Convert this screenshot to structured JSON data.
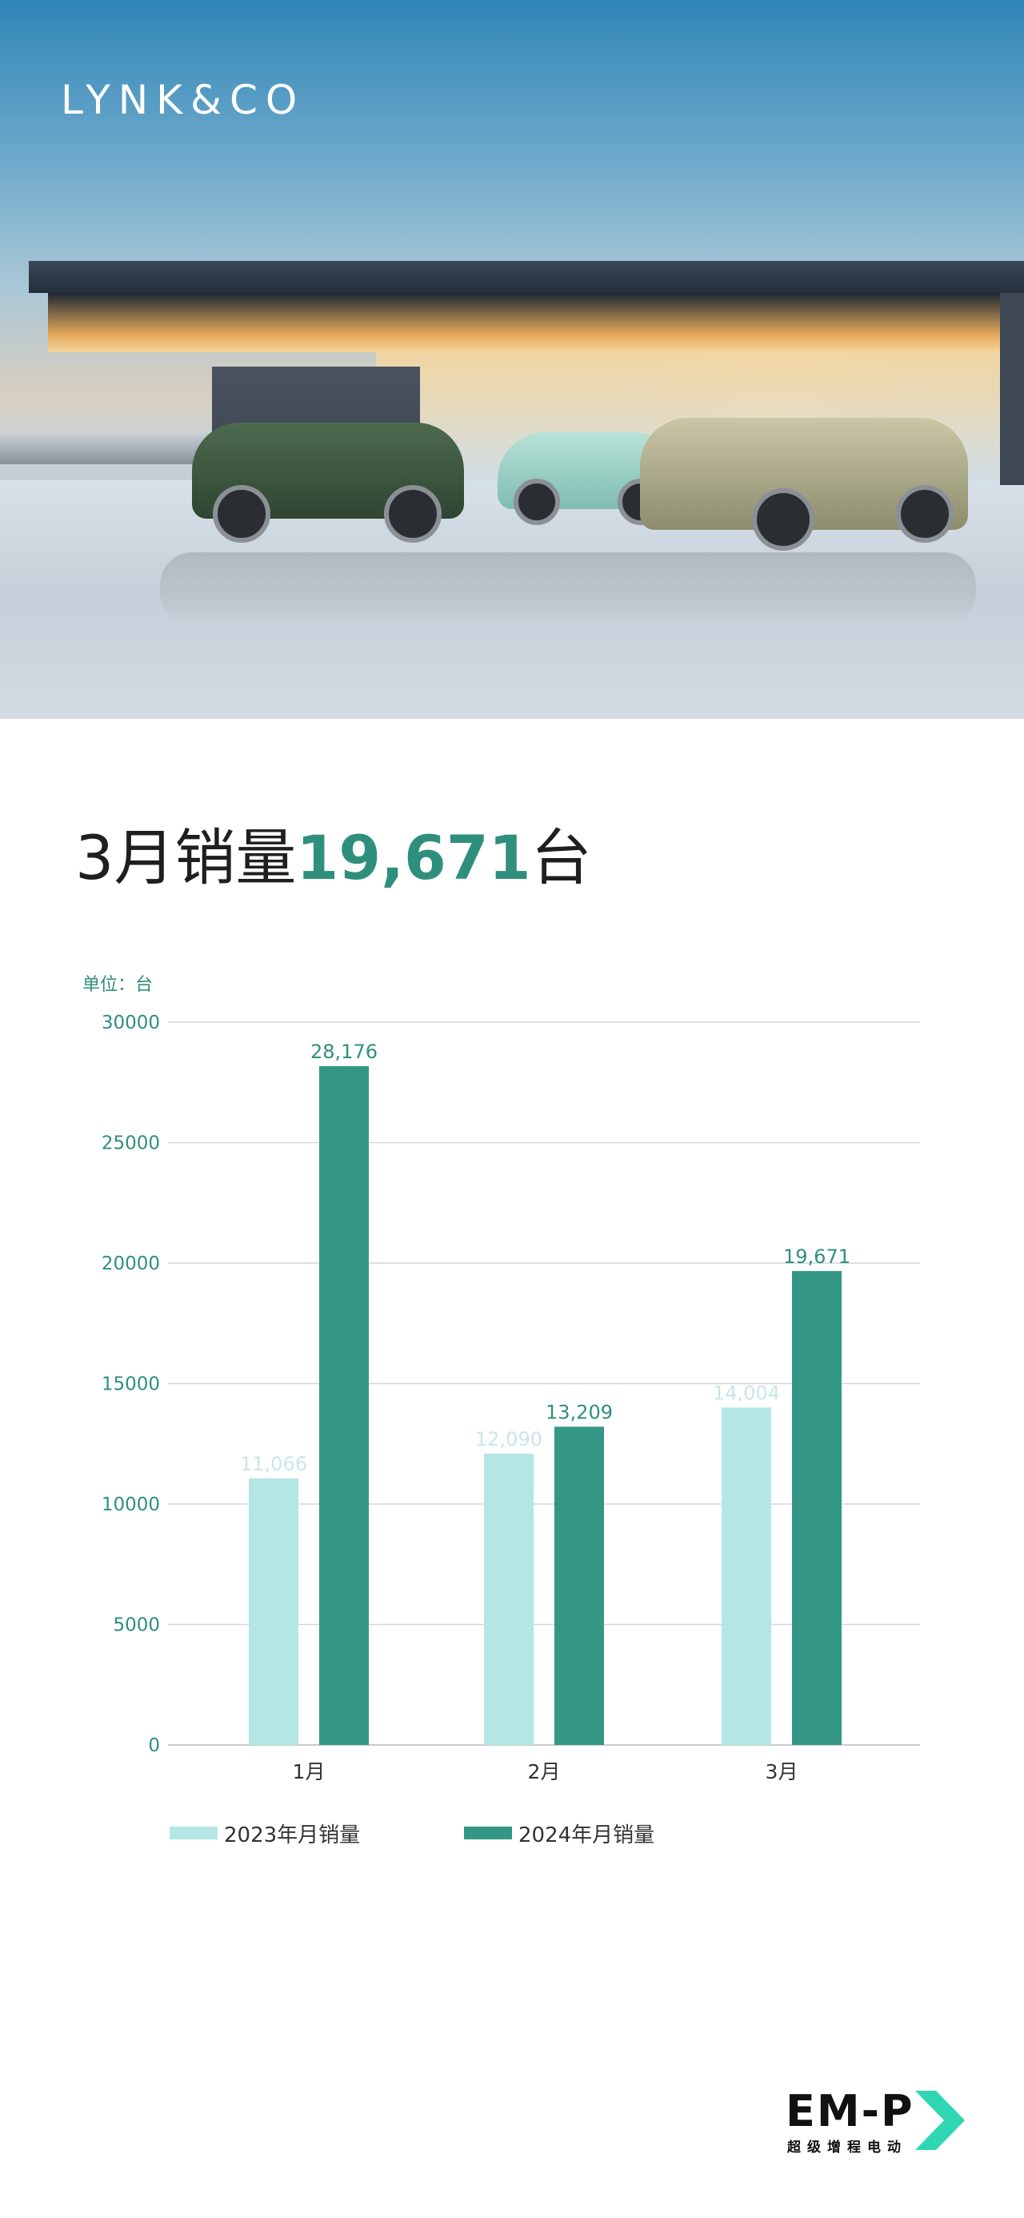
{
  "brand": {
    "logo_text": "LYNK&CO"
  },
  "headline": {
    "prefix": "3月销量",
    "number": "19,671",
    "suffix": "台"
  },
  "chart_data": {
    "type": "bar",
    "unit_label": "单位：台",
    "categories": [
      "1月",
      "2月",
      "3月"
    ],
    "series": [
      {
        "name": "2023年月销量",
        "values": [
          11066,
          12090,
          14004
        ],
        "labels": [
          "11,066",
          "12,090",
          "14,004"
        ],
        "color": "#b4e6e6"
      },
      {
        "name": "2024年月销量",
        "values": [
          28176,
          13209,
          19671
        ],
        "labels": [
          "28,176",
          "13,209",
          "19,671"
        ],
        "color": "#349785"
      }
    ],
    "yticks": [
      "0",
      "5000",
      "10000",
      "15000",
      "20000",
      "25000",
      "30000"
    ],
    "ylim": [
      0,
      30000
    ],
    "grid": true,
    "legend_position": "bottom"
  },
  "footer_logo": {
    "word": "EM-P",
    "tagline": "超级增程电动"
  },
  "colors": {
    "accent": "#2f8f7d",
    "light": "#b4e6e6",
    "dark": "#349785"
  }
}
